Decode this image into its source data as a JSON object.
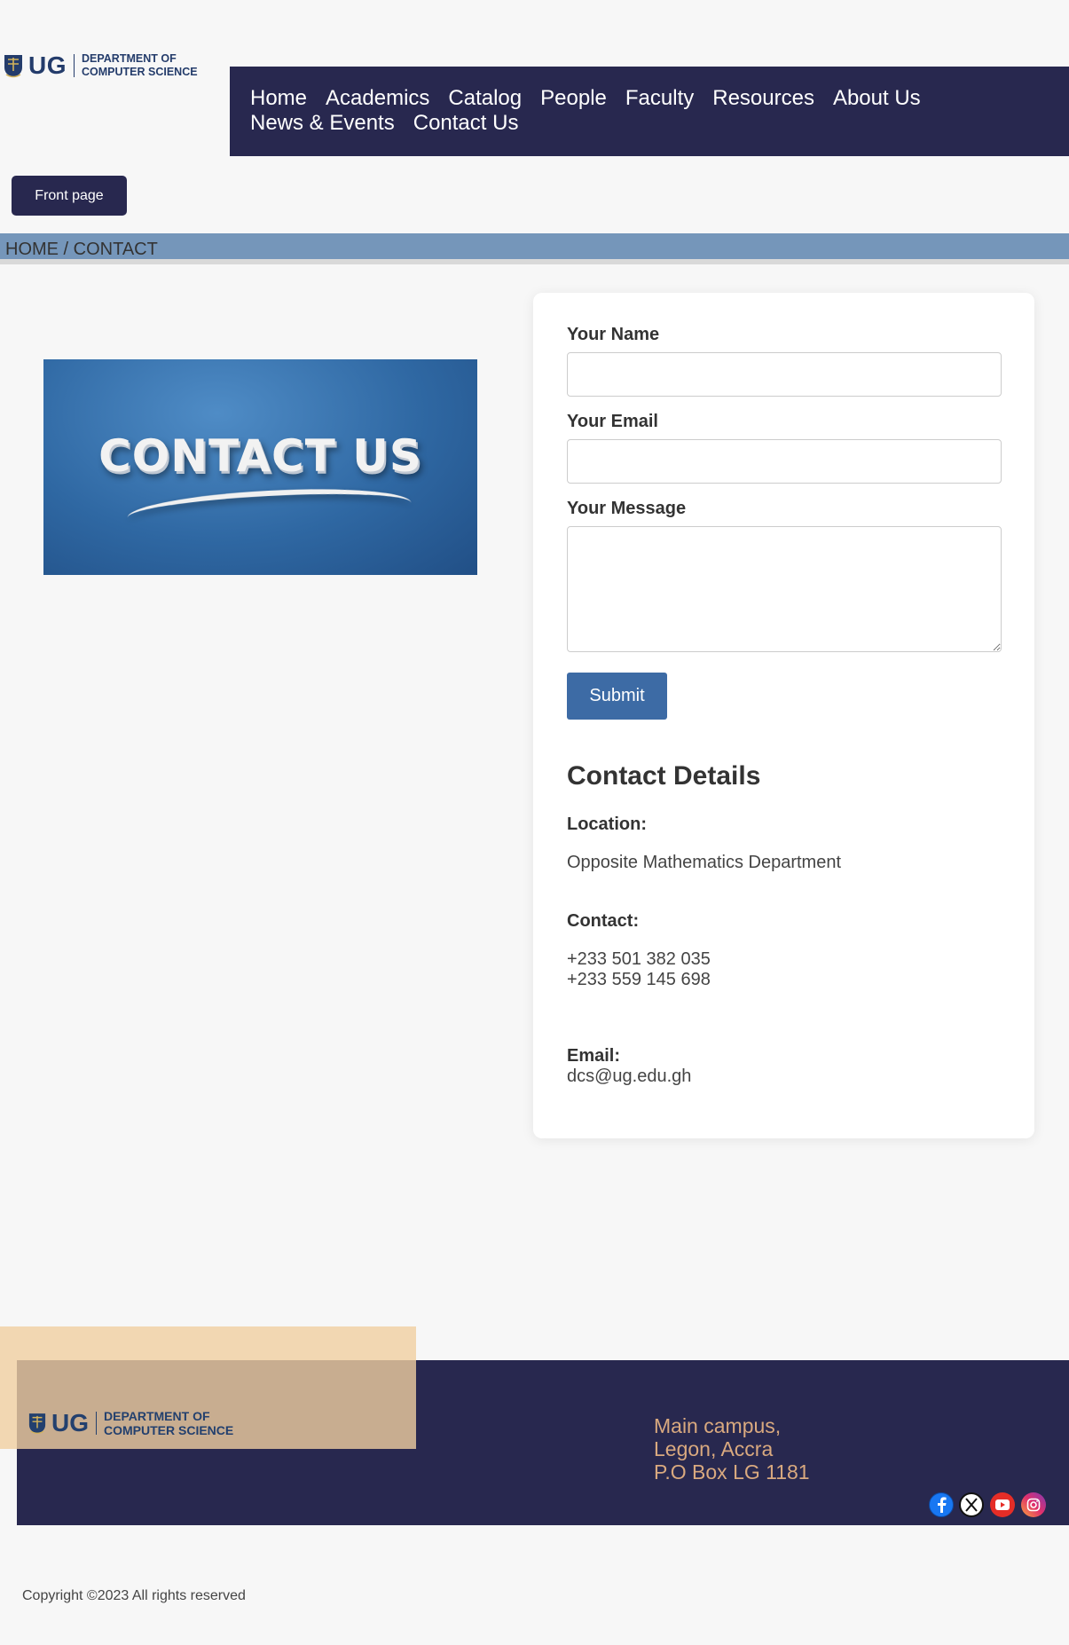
{
  "logo": {
    "ug": "UG",
    "dept_line1": "DEPARTMENT OF",
    "dept_line2": "COMPUTER SCIENCE"
  },
  "nav": {
    "items": [
      "Home",
      "Academics",
      "Catalog",
      "People",
      "Faculty",
      "Resources",
      "About Us",
      "News & Events",
      "Contact Us"
    ]
  },
  "front_page_button": "Front page",
  "breadcrumb": "HOME / CONTACT",
  "image": {
    "text": "CONTACT US"
  },
  "form": {
    "name_label": "Your Name",
    "name_value": "",
    "email_label": "Your Email",
    "email_value": "",
    "message_label": "Your Message",
    "message_value": "",
    "submit_label": "Submit"
  },
  "contact_details": {
    "title": "Contact Details",
    "location_label": "Location:",
    "location_value": "Opposite Mathematics Department",
    "contact_label": "Contact:",
    "phone1": "+233 501 382 035",
    "phone2": "+233 559 145 698",
    "email_label": "Email:",
    "email_value": "dcs@ug.edu.gh"
  },
  "footer": {
    "logo_ug": "UG",
    "dept_line1": "DEPARTMENT OF",
    "dept_line2": "COMPUTER SCIENCE",
    "address_line1": "Main campus,",
    "address_line2": "Legon, Accra",
    "address_line3": "P.O Box LG 1181",
    "social": [
      "facebook-icon",
      "x-icon",
      "youtube-icon",
      "instagram-icon"
    ],
    "copyright": "Copyright ©2023 All rights reserved"
  },
  "colors": {
    "navy": "#28284f",
    "breadcrumb_bg": "#7596ba",
    "submit_blue": "#3d6ba5",
    "address_tan": "#d9a97f"
  }
}
